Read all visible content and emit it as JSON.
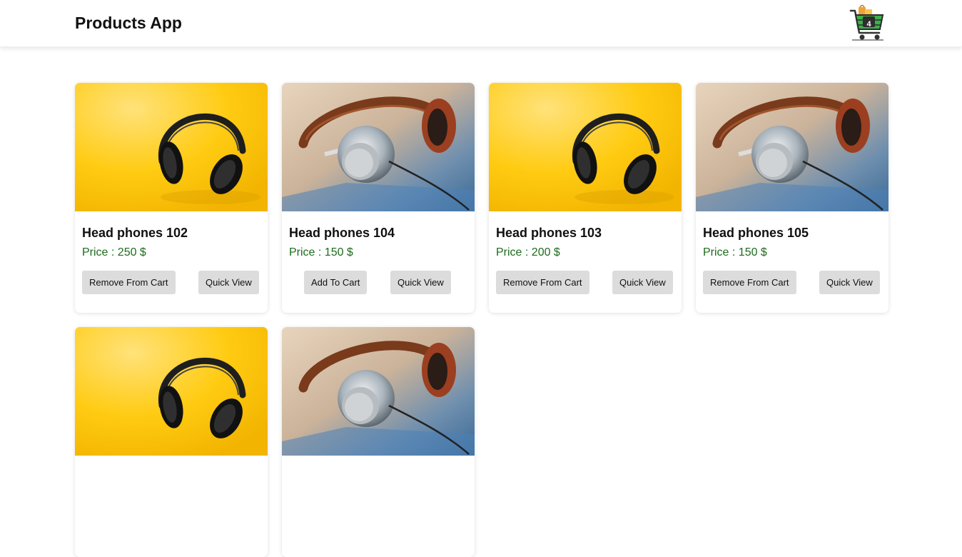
{
  "navbar": {
    "title": "Products App",
    "cart_count": "4",
    "cart_icon": "shopping-cart-icon"
  },
  "products": [
    {
      "name": "Head phones 102",
      "price": "Price : 250 $",
      "cart_label": "Remove From Cart",
      "view_label": "Quick View",
      "image": "yellow-headphones"
    },
    {
      "name": "Head phones 104",
      "price": "Price : 150 $",
      "cart_label": "Add To Cart",
      "view_label": "Quick View",
      "image": "chrome-headphones"
    },
    {
      "name": "Head phones 103",
      "price": "Price : 200 $",
      "cart_label": "Remove From Cart",
      "view_label": "Quick View",
      "image": "yellow-headphones"
    },
    {
      "name": "Head phones 105",
      "price": "Price : 150 $",
      "cart_label": "Remove From Cart",
      "view_label": "Quick View",
      "image": "chrome-headphones"
    },
    {
      "name": "",
      "price": "",
      "cart_label": "",
      "view_label": "",
      "image": "yellow-headphones"
    },
    {
      "name": "",
      "price": "",
      "cart_label": "",
      "view_label": "",
      "image": "chrome-headphones"
    }
  ],
  "colors": {
    "price": "#1d6b1d",
    "button_bg": "#dcdcdc",
    "yellow_bg": "#ffc400"
  }
}
